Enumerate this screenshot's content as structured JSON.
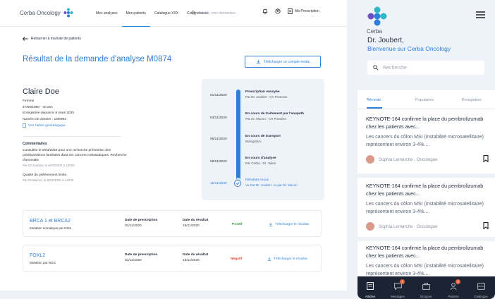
{
  "desktop": {
    "logo_text": "Cerba Oncology",
    "nav": [
      "Mes analyses",
      "Mes patients",
      "Catalogue XXX",
      "Communauté"
    ],
    "search_placeholder": "Patient, mes demandes...",
    "prescription_label": "Ma Prescription",
    "back_label": "Retourner à ma liste de patients",
    "page_title": "Résultat de la demande d'analyse M0874",
    "download_report_label": "Télécharger ce compte-rendu",
    "patient": {
      "name": "Claire Doe",
      "lines": [
        "Femme",
        "27/05/1980 - 40 ans",
        "Enregistrée depuis le 8 mars 2020",
        "Numéro de dossier : 1M0983"
      ],
      "tree_link": "Voir l'arbre généalogique"
    },
    "comments": {
      "title": "Commentaires",
      "items": [
        {
          "text": "Consultée le 6/03/2020 pour une recherche prévention des prédispositions familiales dans les cancers métastatiques. Recherche d'anomalie",
          "meta": "Par Dr.Joubert, le 6/03/2020 à 14h00"
        },
        {
          "text": "Qualité du prélèvement limite.",
          "meta": "Par Dr.Macon, le 6/03/2020 à 14h00"
        }
      ]
    },
    "timeline": [
      {
        "date": "01/11/2020",
        "title": "Prescription envoyée",
        "sub": "Par Dr. Joubert - CH Pontoise"
      },
      {
        "date": "03/11/2020",
        "title": "En cours de traitement par l'anapath",
        "sub": "Par Dr. Macon - CH Pontoise"
      },
      {
        "date": "06/11/2020",
        "title": "En cours de transport",
        "sub": "Biologistics"
      },
      {
        "date": "08/11/2020",
        "title": "En cours d'analyse",
        "sub": "Par Cerba - Dr. Julien"
      },
      {
        "date": "15/11/2020",
        "title": "Résultats reçus",
        "sub": "Vu Par Dr. Joubert, vu par Dr. Macon"
      }
    ],
    "tests": [
      {
        "name": "BRCA 1 et BRCA2",
        "sub": "Mutation somatique par NGS",
        "presc_label": "Date de prescription",
        "presc_date": "01/11/2020",
        "result_label": "Date du résultat",
        "result_date": "15/11/2020",
        "status": "Positif",
        "status_color": "#3aa14a",
        "download": "Télécharger le résultat"
      },
      {
        "name": "FOXL2",
        "sub": "Mutation par NGS",
        "presc_label": "Date de prescription",
        "presc_date": "01/11/2020",
        "result_label": "Date du résultat",
        "result_date": "15/11/2020",
        "status": "Négatif",
        "status_color": "#e0452d",
        "download": "Télécharger le résultat"
      }
    ]
  },
  "mobile": {
    "logo_text": "Cerba",
    "hello": "Dr. Joubert,",
    "welcome": "Bienvenue sur Cerba Oncology",
    "search_placeholder": "Recherche",
    "tabs": [
      "Récents",
      "Populaires",
      "Enregistrés"
    ],
    "articles": [
      {
        "title": "KEYNOTE-164 confirme la place du pembrolizumab chez les patients avec...",
        "text": "Les cancers du côlon MSI (instabilité microsatellitaire) représentent environ 3-4%....",
        "author": "Sophia Lemarche . Oncologue"
      },
      {
        "title": "KEYNOTE-164 confirme la place du pembrolizumab chez les patients avec...",
        "text": "Les cancers du côlon MSI (instabilité microsatellitaire) représentent environ 3-4%....",
        "author": "Sophia Lemarche . Oncologue"
      },
      {
        "title": "KEYNOTE-164 confirme la place du pembrolizumab chez les patients avec...",
        "text": "Les cancers du côlon MSI (instabilité microsatellitaire) représentent environ 3-4%....",
        "author": ""
      }
    ],
    "bottom_nav": [
      {
        "label": "Articles",
        "icon": "articles-icon",
        "badge": ""
      },
      {
        "label": "Messages",
        "icon": "messages-icon",
        "badge": "2"
      },
      {
        "label": "Groupes",
        "icon": "groups-icon",
        "badge": ""
      },
      {
        "label": "Patients",
        "icon": "patients-icon",
        "badge": "2"
      },
      {
        "label": "Catalogue",
        "icon": "catalogue-icon",
        "badge": ""
      }
    ]
  }
}
